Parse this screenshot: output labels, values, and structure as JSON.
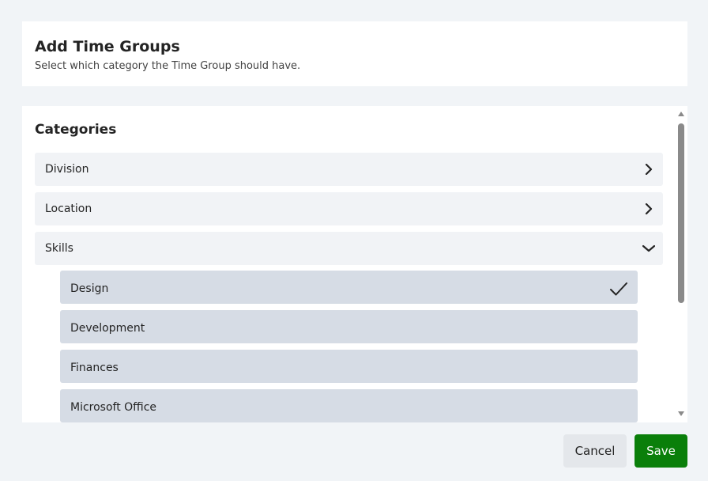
{
  "header": {
    "title": "Add Time Groups",
    "subtitle": "Select which category the Time Group should have."
  },
  "categories": {
    "title": "Categories",
    "items": [
      {
        "label": "Division",
        "state": "collapsed",
        "icon": "chevron-right-icon"
      },
      {
        "label": "Location",
        "state": "collapsed",
        "icon": "chevron-right-icon"
      },
      {
        "label": "Skills",
        "state": "expanded",
        "icon": "chevron-down-icon"
      }
    ],
    "skills_options": [
      {
        "label": "Design",
        "selected": true,
        "icon": "checkmark-icon"
      },
      {
        "label": "Development",
        "selected": false
      },
      {
        "label": "Finances",
        "selected": false
      },
      {
        "label": "Microsoft Office",
        "selected": false
      }
    ]
  },
  "footer": {
    "cancel_label": "Cancel",
    "save_label": "Save"
  },
  "colors": {
    "page_background": "#f1f4f7",
    "card_background": "#ffffff",
    "category_row": "#f1f3f6",
    "option_row": "#d6dce5",
    "save_button": "#0a7f0a",
    "cancel_button": "#e4e7eb"
  }
}
